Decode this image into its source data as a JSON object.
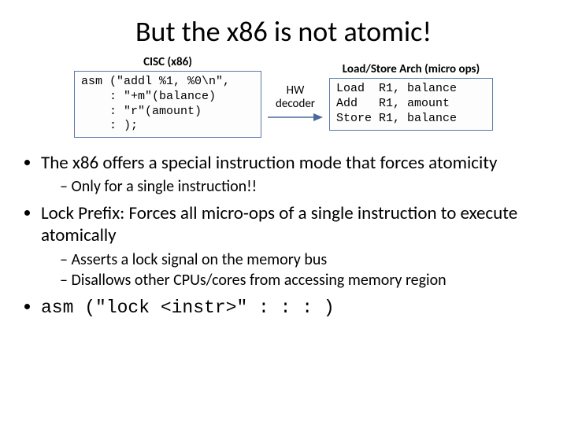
{
  "title": "But the x86 is not atomic!",
  "left_header": "CISC (x86)",
  "left_code": "asm (\"addl %1, %0\\n\",\n    : \"+m\"(balance)\n    : \"r\"(amount)\n    : );",
  "connector_label_line1": "HW",
  "connector_label_line2": "decoder",
  "right_header": "Load/Store Arch (micro ops)",
  "right_code": "Load  R1, balance\nAdd   R1, amount\nStore R1, balance",
  "bullets": {
    "b1": "The x86 offers a special instruction mode that forces atomicity",
    "b1s1": "Only for a single instruction!!",
    "b2": "Lock Prefix: Forces all micro-ops of a single instruction to execute atomically",
    "b2s1": "Asserts a lock signal on the memory bus",
    "b2s2": "Disallows other CPUs/cores from accessing memory region",
    "b3": "asm (\"lock <instr>\" : : : )"
  }
}
